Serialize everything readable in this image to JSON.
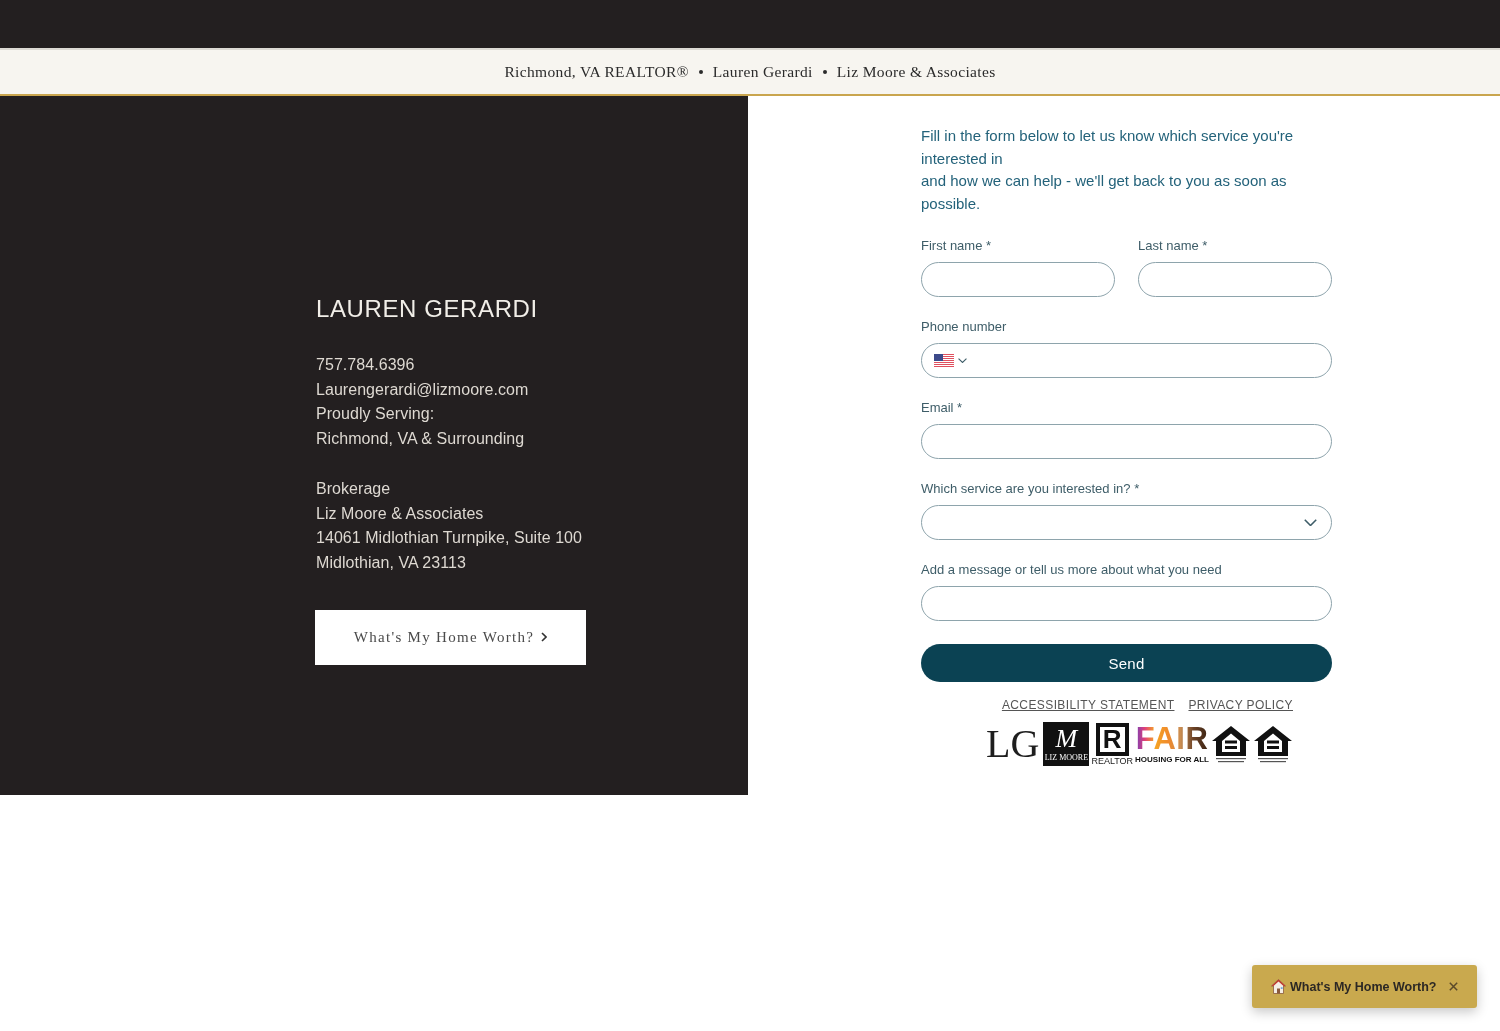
{
  "header": {
    "items": [
      "Richmond, VA REALTOR®",
      "Lauren Gerardi",
      "Liz Moore & Associates"
    ]
  },
  "agent": {
    "name": "LAUREN GERARDI",
    "contact_lines": [
      "757.784.6396",
      "Laurengerardi@lizmoore.com",
      "Proudly Serving:",
      "Richmond, VA & Surrounding"
    ],
    "brokerage_lines": [
      "Brokerage",
      "Liz Moore & Associates",
      "14061 Midlothian Turnpike, Suite 100",
      "Midlothian, VA 23113"
    ],
    "cta_button": "What's My Home Worth?"
  },
  "form": {
    "intro": [
      "Fill in the form below to let us know which service you're interested in",
      "and how we can help - we'll get back to you as soon as possible."
    ],
    "rows": [
      [
        {
          "kind": "text",
          "label": "First name *"
        },
        {
          "kind": "text",
          "label": "Last name *"
        }
      ],
      [
        {
          "kind": "phone",
          "label": "Phone number"
        }
      ],
      [
        {
          "kind": "text",
          "label": "Email *"
        }
      ],
      [
        {
          "kind": "select",
          "label": "Which service are you interested in? *"
        }
      ],
      [
        {
          "kind": "text",
          "label": "Add a message or tell us more about what you need"
        }
      ]
    ],
    "submit": "Send"
  },
  "footer": {
    "links": [
      "ACCESSIBILITY STATEMENT",
      "PRIVACY POLICY"
    ],
    "logos": [
      {
        "kind": "monogram",
        "text": "LG"
      },
      {
        "kind": "brokerage",
        "mark": "M",
        "text": "LIZ MOORE"
      },
      {
        "kind": "realtor",
        "mark": "R",
        "caption": "REALTOR"
      },
      {
        "kind": "fair-housing",
        "text": "FAIR",
        "caption": "HOUSING FOR ALL"
      },
      {
        "kind": "equal-housing"
      },
      {
        "kind": "equal-housing"
      }
    ]
  },
  "widget": {
    "label": "What's My Home Worth?"
  }
}
